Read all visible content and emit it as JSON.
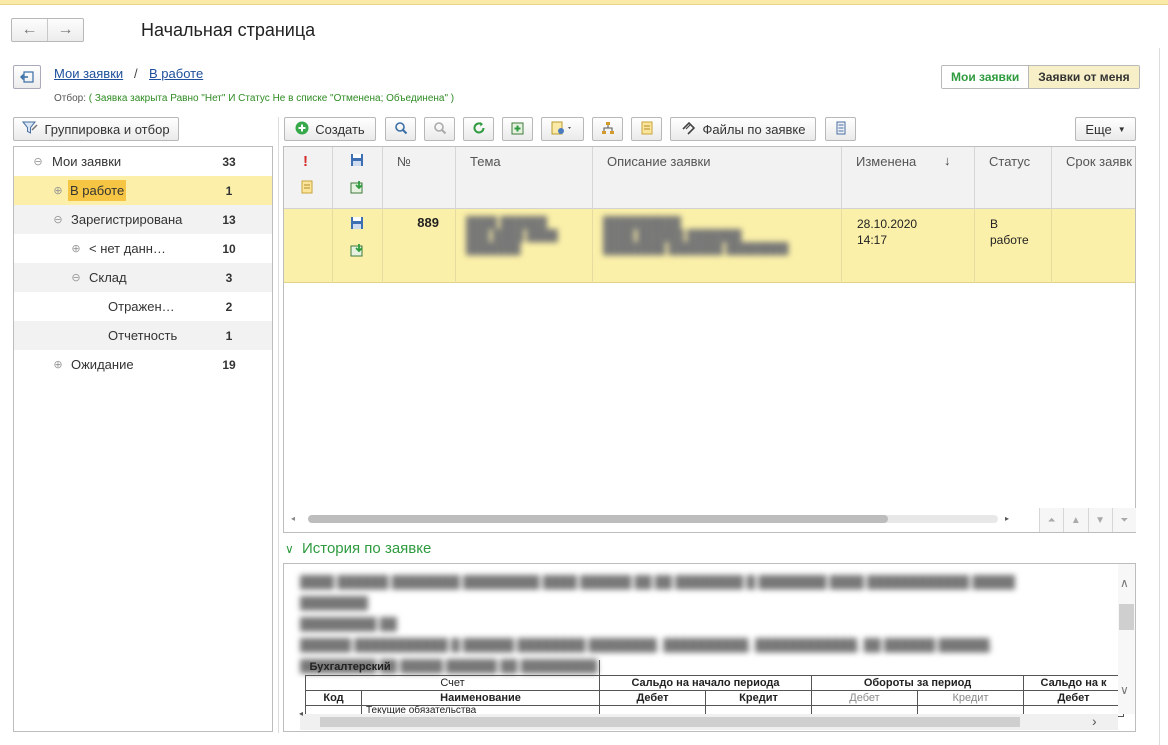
{
  "page": {
    "title": "Начальная страница"
  },
  "breadcrumb": {
    "item1": "Мои заявки",
    "sep": "/",
    "item2": "В работе"
  },
  "filter": {
    "prefix": "Отбор:",
    "text": "( Заявка закрыта Равно \"Нет\" И Статус Не в списке \"Отменена; Объединена\" )"
  },
  "tabs": {
    "my": "Мои заявки",
    "from_me": "Заявки от меня"
  },
  "toolbar": {
    "group_filter": "Группировка и отбор",
    "create": "Создать",
    "files": "Файлы по заявке",
    "more": "Еще"
  },
  "tree": {
    "items": [
      {
        "label": "Мои заявки",
        "count": "33",
        "expander": "⊖"
      },
      {
        "label": "В работе",
        "count": "1",
        "expander": "⊕"
      },
      {
        "label": "Зарегистрирована",
        "count": "13",
        "expander": "⊖"
      },
      {
        "label": "< нет данн…",
        "count": "10",
        "expander": "⊕"
      },
      {
        "label": "Склад",
        "count": "3",
        "expander": "⊖"
      },
      {
        "label": "Отражен…",
        "count": "2",
        "expander": ""
      },
      {
        "label": "Отчетность",
        "count": "1",
        "expander": ""
      },
      {
        "label": "Ожидание",
        "count": "19",
        "expander": "⊕"
      }
    ]
  },
  "grid": {
    "columns": {
      "num": "№",
      "topic": "Тема",
      "description": "Описание заявки",
      "changed": "Изменена",
      "status": "Статус",
      "deadline": "Срок заявк"
    },
    "sort_indicator": "↓",
    "rows": [
      {
        "num": "889",
        "changed_date": "28.10.2020",
        "changed_time": "14:17",
        "status_line1": "В",
        "status_line2": "работе"
      }
    ]
  },
  "history": {
    "title": "История по заявке",
    "report": {
      "section": "Бухгалтерский",
      "h_account": "Счет",
      "h_start": "Сальдо на начало периода",
      "h_turnover": "Обороты за период",
      "h_end": "Сальдо на к",
      "h_code": "Код",
      "h_name": "Наименование",
      "h_debit": "Дебет",
      "h_credit": "Кредит",
      "row_name": "Текущие обязательства"
    }
  },
  "colors": {
    "accent_green": "#2e9b3f",
    "selection": "#fbf0a9",
    "highlight": "#f6c543",
    "link": "#1d4f9a"
  }
}
